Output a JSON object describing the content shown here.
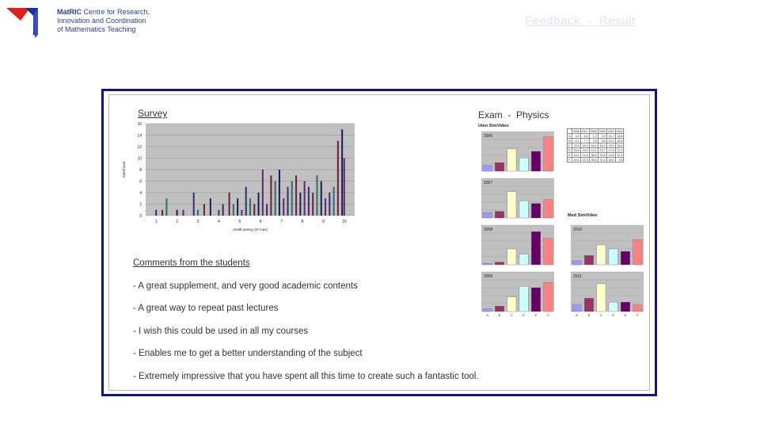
{
  "header": {
    "logo_brand": "MatRIC",
    "logo_line1": "Centre for Research,",
    "logo_line2": "Innovation and Coordination",
    "logo_line3": "of Mathematics Teaching",
    "title": "Feedback  -  Result"
  },
  "survey": {
    "title": "Survey",
    "chart_data": {
      "type": "bar",
      "ylabel": "Antall svar",
      "xlabel": "Antall poeng (10 max)",
      "xticks": [
        "1",
        "2",
        "3",
        "4",
        "5",
        "6",
        "7",
        "8",
        "9",
        "10"
      ],
      "yticks": [
        "0",
        "2",
        "4",
        "6",
        "8",
        "10",
        "12",
        "14",
        "16"
      ],
      "ylim": [
        0,
        16
      ],
      "x": [
        1,
        1.3,
        1.5,
        2,
        2.3,
        2.8,
        3,
        3.3,
        3.6,
        4,
        4.2,
        4.5,
        4.7,
        4.9,
        5.1,
        5.3,
        5.5,
        5.7,
        5.9,
        6.1,
        6.3,
        6.5,
        6.7,
        6.9,
        7.1,
        7.3,
        7.5,
        7.7,
        7.9,
        8.1,
        8.3,
        8.5,
        8.7,
        8.9,
        9.1,
        9.3,
        9.5,
        9.7,
        9.9,
        10
      ],
      "values": [
        1,
        1,
        3,
        1,
        1,
        4,
        1,
        2,
        3,
        1,
        2,
        4,
        2,
        3,
        1,
        5,
        3,
        2,
        4,
        8,
        2,
        7,
        6,
        8,
        3,
        5,
        6,
        7,
        4,
        6,
        5,
        4,
        7,
        6,
        3,
        4,
        5,
        13,
        15,
        10
      ],
      "colors": [
        "#3b2a7a",
        "#6a1f3a",
        "#2e6e6a",
        "#1c1c5a",
        "#5a2a6a",
        "#3b2a7a",
        "#2e6e6a",
        "#6a1f3a",
        "#1c1c5a",
        "#5a2a6a"
      ]
    }
  },
  "comments": {
    "title": "Comments from the students",
    "items": [
      "- A great supplement, and very good academic contents",
      "- A great way to repeat past lectures",
      "- I wish this could be used in all my courses",
      "- Enables me to get a better understanding of the subject",
      "- Extremely impressive that you have spent all this time to create such a fantastic tool."
    ]
  },
  "exam": {
    "title": "Exam  -  Physics",
    "uten_label": "Uten SimVideo",
    "med_label": "Med SimVideo",
    "grades": [
      "A",
      "B",
      "C",
      "D",
      "E",
      "F"
    ],
    "bar_colors": [
      "#9999ff",
      "#993366",
      "#ffffcc",
      "#ccffff",
      "#660066",
      "#ff8080"
    ],
    "charts": [
      {
        "year": "2006",
        "values": [
          4.5,
          6.5,
          17,
          10,
          15,
          26
        ]
      },
      {
        "year": "2007",
        "values": [
          4,
          5,
          20,
          13,
          11,
          14
        ]
      },
      {
        "year": "2008",
        "values": [
          1,
          2,
          12,
          8,
          25,
          20
        ]
      },
      {
        "year": "2009",
        "values": [
          2,
          4,
          11,
          19,
          18,
          22
        ]
      },
      {
        "year": "2010",
        "values": [
          3,
          7,
          15,
          12,
          10,
          19
        ]
      },
      {
        "year": "2011",
        "values": [
          5,
          10,
          21,
          7,
          7,
          5
        ]
      }
    ],
    "table": {
      "header": [
        "",
        "2006",
        "2007",
        "2008",
        "2009",
        "2010",
        "2011"
      ],
      "rows": [
        [
          "A",
          "4,5",
          "6,5",
          "1,3",
          "2,4",
          "11,7",
          "15,6"
        ],
        [
          "B",
          "6,1",
          "7,7",
          "2,6",
          "5,6",
          "10,1",
          "15,0"
        ],
        [
          "C",
          "22,0",
          "24,3",
          "18,4",
          "16,0",
          "23,0",
          "35,6"
        ],
        [
          "D",
          "15,6",
          "15,5",
          "12,1",
          "24,7",
          "17,4",
          "11,1"
        ],
        [
          "E",
          "18,1",
          "11,5",
          "38,0",
          "24,6",
          "13,6",
          "12,4"
        ],
        [
          "F",
          "34,4",
          "33,3",
          "38,6",
          "37,8",
          "28,2",
          "9,6"
        ]
      ]
    }
  }
}
